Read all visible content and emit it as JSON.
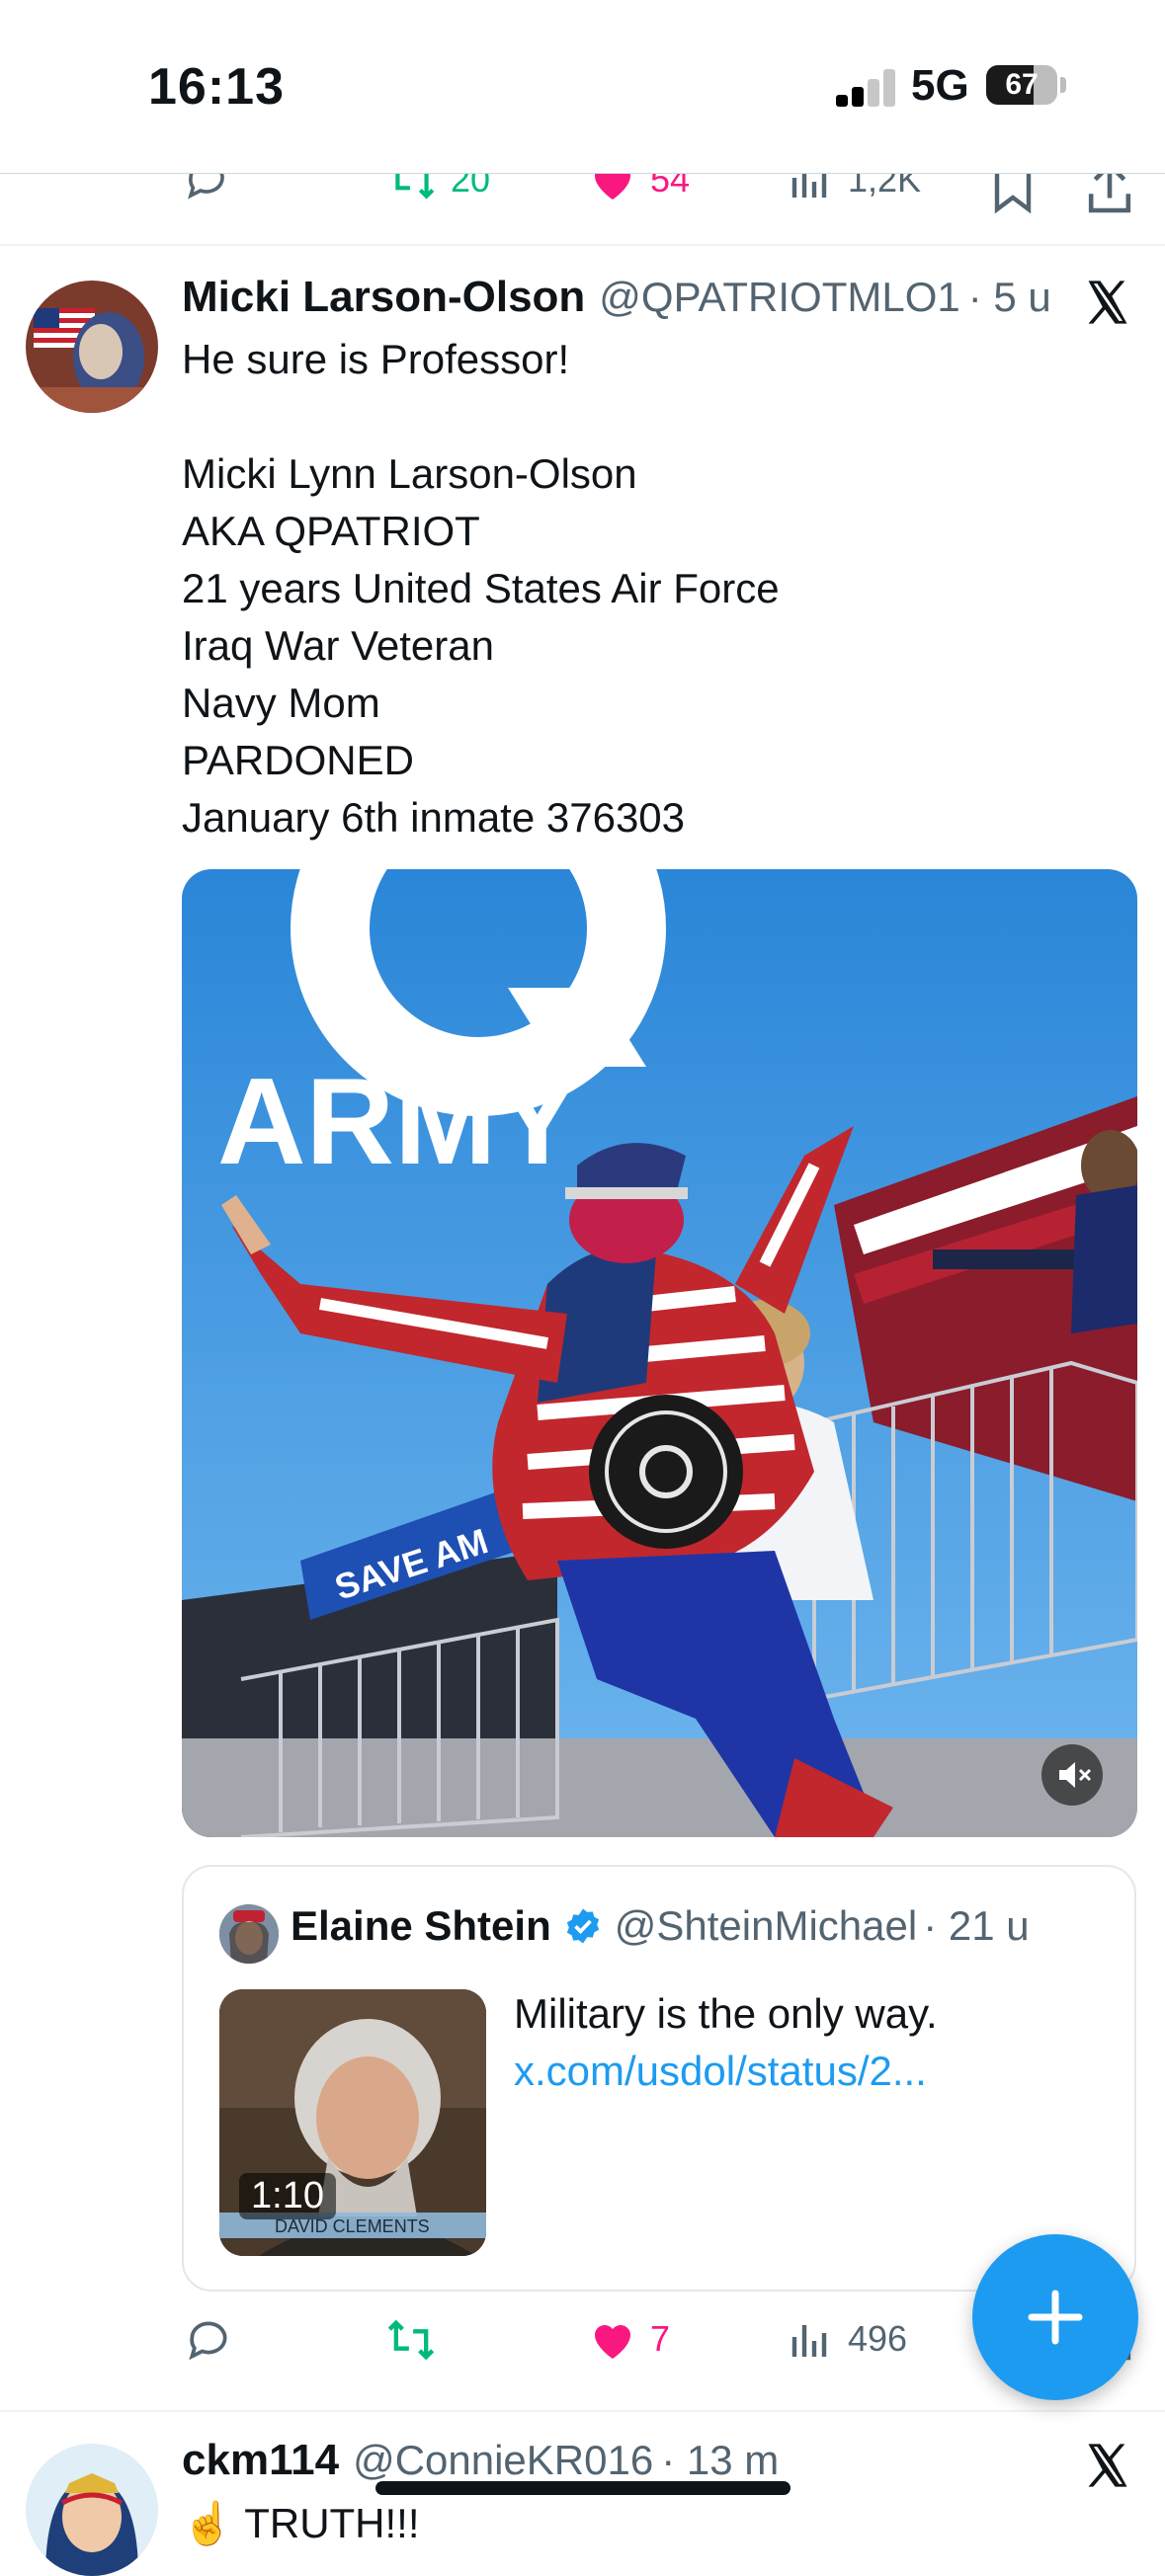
{
  "status_bar": {
    "time": "16:13",
    "network": "5G",
    "battery": "67",
    "battery_level": 0.67
  },
  "top_actions": {
    "retweets": "20",
    "likes": "54",
    "views": "1,2K"
  },
  "tweet": {
    "name": "Micki Larson-Olson",
    "handle": "@QPATRIOTMLO1",
    "time": "· 5 u",
    "lines": [
      "He sure is Professor!",
      "",
      "Micki Lynn Larson-Olson",
      "AKA QPATRIOT",
      "21 years United States Air Force",
      "Iraq War Veteran",
      "Navy Mom",
      "PARDONED",
      "January 6th inmate 376303"
    ],
    "media_overlay_text": "ARMY",
    "media_sign_text": "SAVE AM",
    "quote": {
      "name": "Elaine Shtein",
      "handle": "@ShteinMichael",
      "time": "· 21 u",
      "text": "Military is the only way.",
      "link": "x.com/usdol/status/2...",
      "video_duration": "1:10",
      "video_caption": "DAVID CLEMENTS"
    },
    "actions": {
      "likes": "7",
      "views": "496"
    }
  },
  "next_tweet": {
    "name": "ckm114",
    "handle": "@ConnieKR016",
    "time": "· 13 m",
    "text_start": "☝️ TRUTH!!!"
  },
  "colors": {
    "accent": "#1d9bf0",
    "like": "#f91880",
    "retweet": "#00ba7c",
    "muted": "#536471"
  },
  "icons": [
    "reply-icon",
    "retweet-icon",
    "heart-icon",
    "views-icon",
    "bookmark-icon",
    "share-icon",
    "x-logo-icon",
    "verified-icon",
    "mute-icon",
    "plus-icon"
  ]
}
